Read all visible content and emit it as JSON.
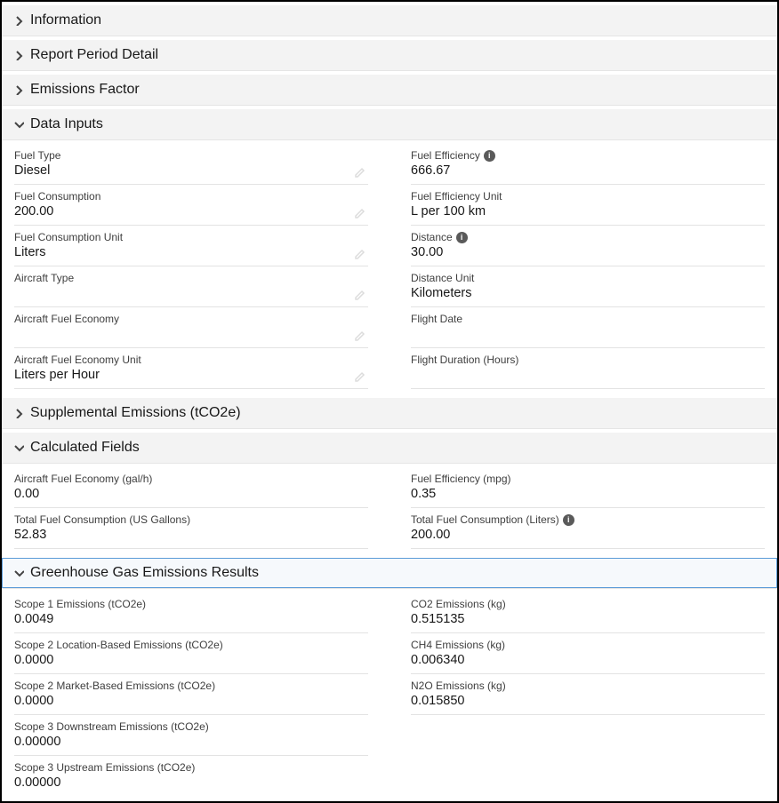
{
  "sections": {
    "information": {
      "title": "Information"
    },
    "reportPeriod": {
      "title": "Report Period Detail"
    },
    "emissionsFactor": {
      "title": "Emissions Factor"
    },
    "dataInputs": {
      "title": "Data Inputs",
      "left": {
        "fuelType": {
          "label": "Fuel Type",
          "value": "Diesel"
        },
        "fuelConsumption": {
          "label": "Fuel Consumption",
          "value": "200.00"
        },
        "fuelConsumptionUnit": {
          "label": "Fuel Consumption Unit",
          "value": "Liters"
        },
        "aircraftType": {
          "label": "Aircraft Type",
          "value": ""
        },
        "aircraftFuelEconomy": {
          "label": "Aircraft Fuel Economy",
          "value": ""
        },
        "aircraftFuelEconomyUnit": {
          "label": "Aircraft Fuel Economy Unit",
          "value": "Liters per Hour"
        }
      },
      "right": {
        "fuelEfficiency": {
          "label": "Fuel Efficiency",
          "value": "666.67"
        },
        "fuelEfficiencyUnit": {
          "label": "Fuel Efficiency Unit",
          "value": "L per 100 km"
        },
        "distance": {
          "label": "Distance",
          "value": "30.00"
        },
        "distanceUnit": {
          "label": "Distance Unit",
          "value": "Kilometers"
        },
        "flightDate": {
          "label": "Flight Date",
          "value": ""
        },
        "flightDuration": {
          "label": "Flight Duration (Hours)",
          "value": ""
        }
      }
    },
    "supplemental": {
      "title": "Supplemental Emissions (tCO2e)"
    },
    "calculated": {
      "title": "Calculated Fields",
      "left": {
        "afeGal": {
          "label": "Aircraft Fuel Economy (gal/h)",
          "value": "0.00"
        },
        "tfcGal": {
          "label": "Total Fuel Consumption (US Gallons)",
          "value": "52.83"
        }
      },
      "right": {
        "feMpg": {
          "label": "Fuel Efficiency (mpg)",
          "value": "0.35"
        },
        "tfcL": {
          "label": "Total Fuel Consumption (Liters)",
          "value": "200.00"
        }
      }
    },
    "ghg": {
      "title": "Greenhouse Gas Emissions Results",
      "left": {
        "s1": {
          "label": "Scope 1 Emissions (tCO2e)",
          "value": "0.0049"
        },
        "s2l": {
          "label": "Scope 2 Location-Based Emissions (tCO2e)",
          "value": "0.0000"
        },
        "s2m": {
          "label": "Scope 2 Market-Based Emissions (tCO2e)",
          "value": "0.0000"
        },
        "s3d": {
          "label": "Scope 3 Downstream Emissions (tCO2e)",
          "value": "0.00000"
        },
        "s3u": {
          "label": "Scope 3 Upstream Emissions (tCO2e)",
          "value": "0.00000"
        }
      },
      "right": {
        "co2": {
          "label": "CO2 Emissions (kg)",
          "value": "0.515135"
        },
        "ch4": {
          "label": "CH4 Emissions (kg)",
          "value": "0.006340"
        },
        "n2o": {
          "label": "N2O Emissions (kg)",
          "value": "0.015850"
        }
      }
    }
  }
}
